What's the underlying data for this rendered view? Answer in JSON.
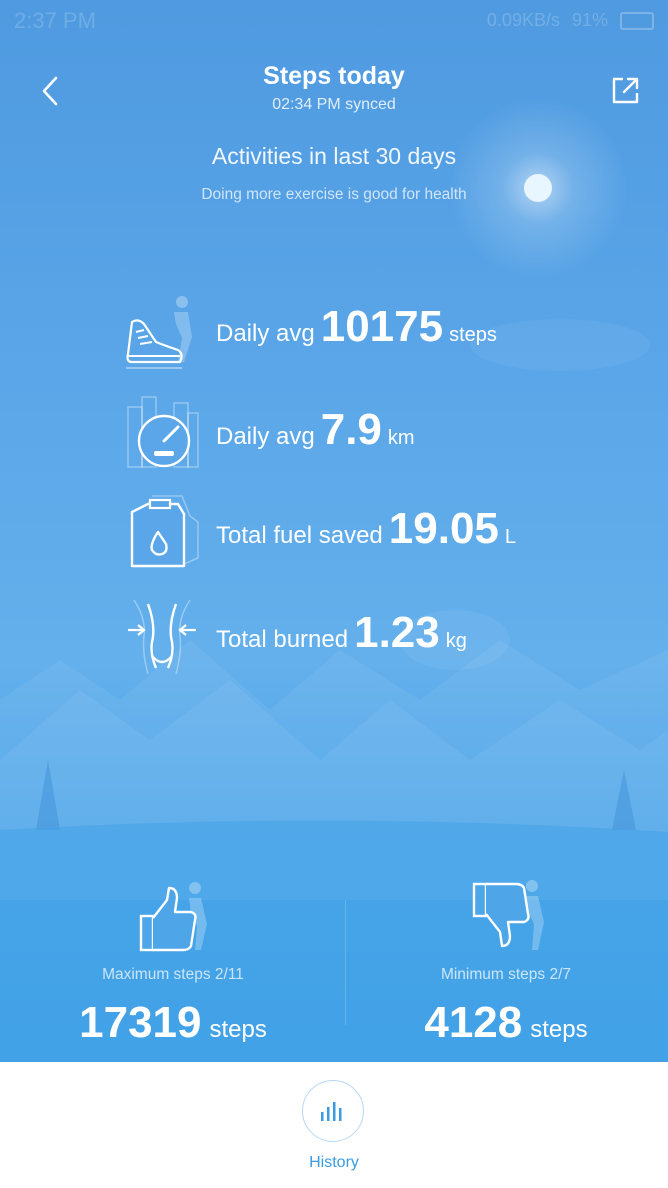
{
  "status_bar": {
    "time": "2:37 PM",
    "network_speed": "0.09KB/s",
    "battery": "91%"
  },
  "header": {
    "title": "Steps today",
    "synced": "02:34 PM synced",
    "back_icon": "chevron-left-icon",
    "share_icon": "share-external-icon"
  },
  "activities": {
    "title": "Activities in last 30 days",
    "subtitle": "Doing more exercise is good for health"
  },
  "stats": [
    {
      "icon": "walking-shoe-icon",
      "label": "Daily avg",
      "value": "10175",
      "unit": "steps"
    },
    {
      "icon": "speedometer-icon",
      "label": "Daily avg",
      "value": "7.9",
      "unit": "km"
    },
    {
      "icon": "fuel-can-icon",
      "label": "Total fuel saved",
      "value": "19.05",
      "unit": "L"
    },
    {
      "icon": "waist-measure-icon",
      "label": "Total burned",
      "value": "1.23",
      "unit": "kg"
    }
  ],
  "summary": {
    "max": {
      "icon": "thumbs-up-icon",
      "label": "Maximum steps 2/11",
      "value": "17319",
      "unit": "steps"
    },
    "min": {
      "icon": "thumbs-down-icon",
      "label": "Minimum steps 2/7",
      "value": "4128",
      "unit": "steps"
    }
  },
  "bottom_nav": {
    "history_label": "History",
    "history_icon": "bar-chart-icon"
  },
  "colors": {
    "background_top": "#4f9ae0",
    "background_bottom": "#3ea0e6",
    "accent": "#3a9be0"
  }
}
